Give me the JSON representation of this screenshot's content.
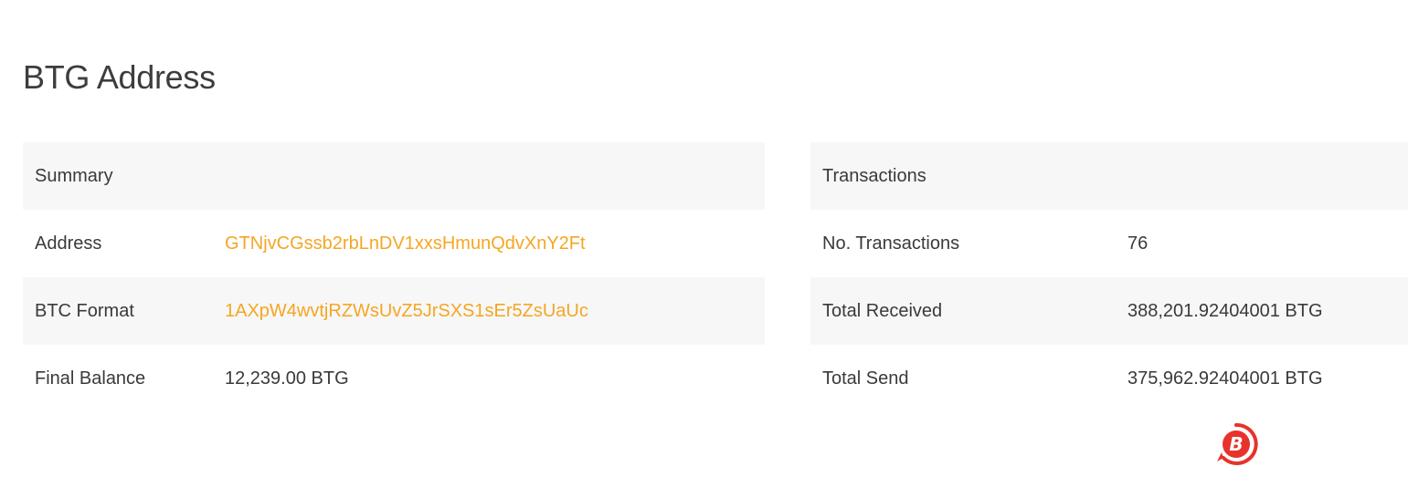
{
  "page": {
    "title": "BTG Address"
  },
  "summary": {
    "header": "Summary",
    "rows": [
      {
        "label": "Address",
        "value": "GTNjvCGssb2rbLnDV1xxsHmunQdvXnY2Ft"
      },
      {
        "label": "BTC Format",
        "value": "1AXpW4wvtjRZWsUvZ5JrSXS1sEr5ZsUaUc"
      },
      {
        "label": "Final Balance",
        "value": "12,239.00 BTG"
      }
    ]
  },
  "transactions": {
    "header": "Transactions",
    "rows": [
      {
        "label": "No. Transactions",
        "value": "76"
      },
      {
        "label": "Total Received",
        "value": "388,201.92404001 BTG"
      },
      {
        "label": "Total Send",
        "value": "375,962.92404001 BTG"
      }
    ]
  },
  "colors": {
    "link": "#f5a623",
    "row_shade": "#f7f7f7",
    "watermark": "#e8322c"
  },
  "watermark": {
    "icon": "bitcoin-logo-icon"
  }
}
